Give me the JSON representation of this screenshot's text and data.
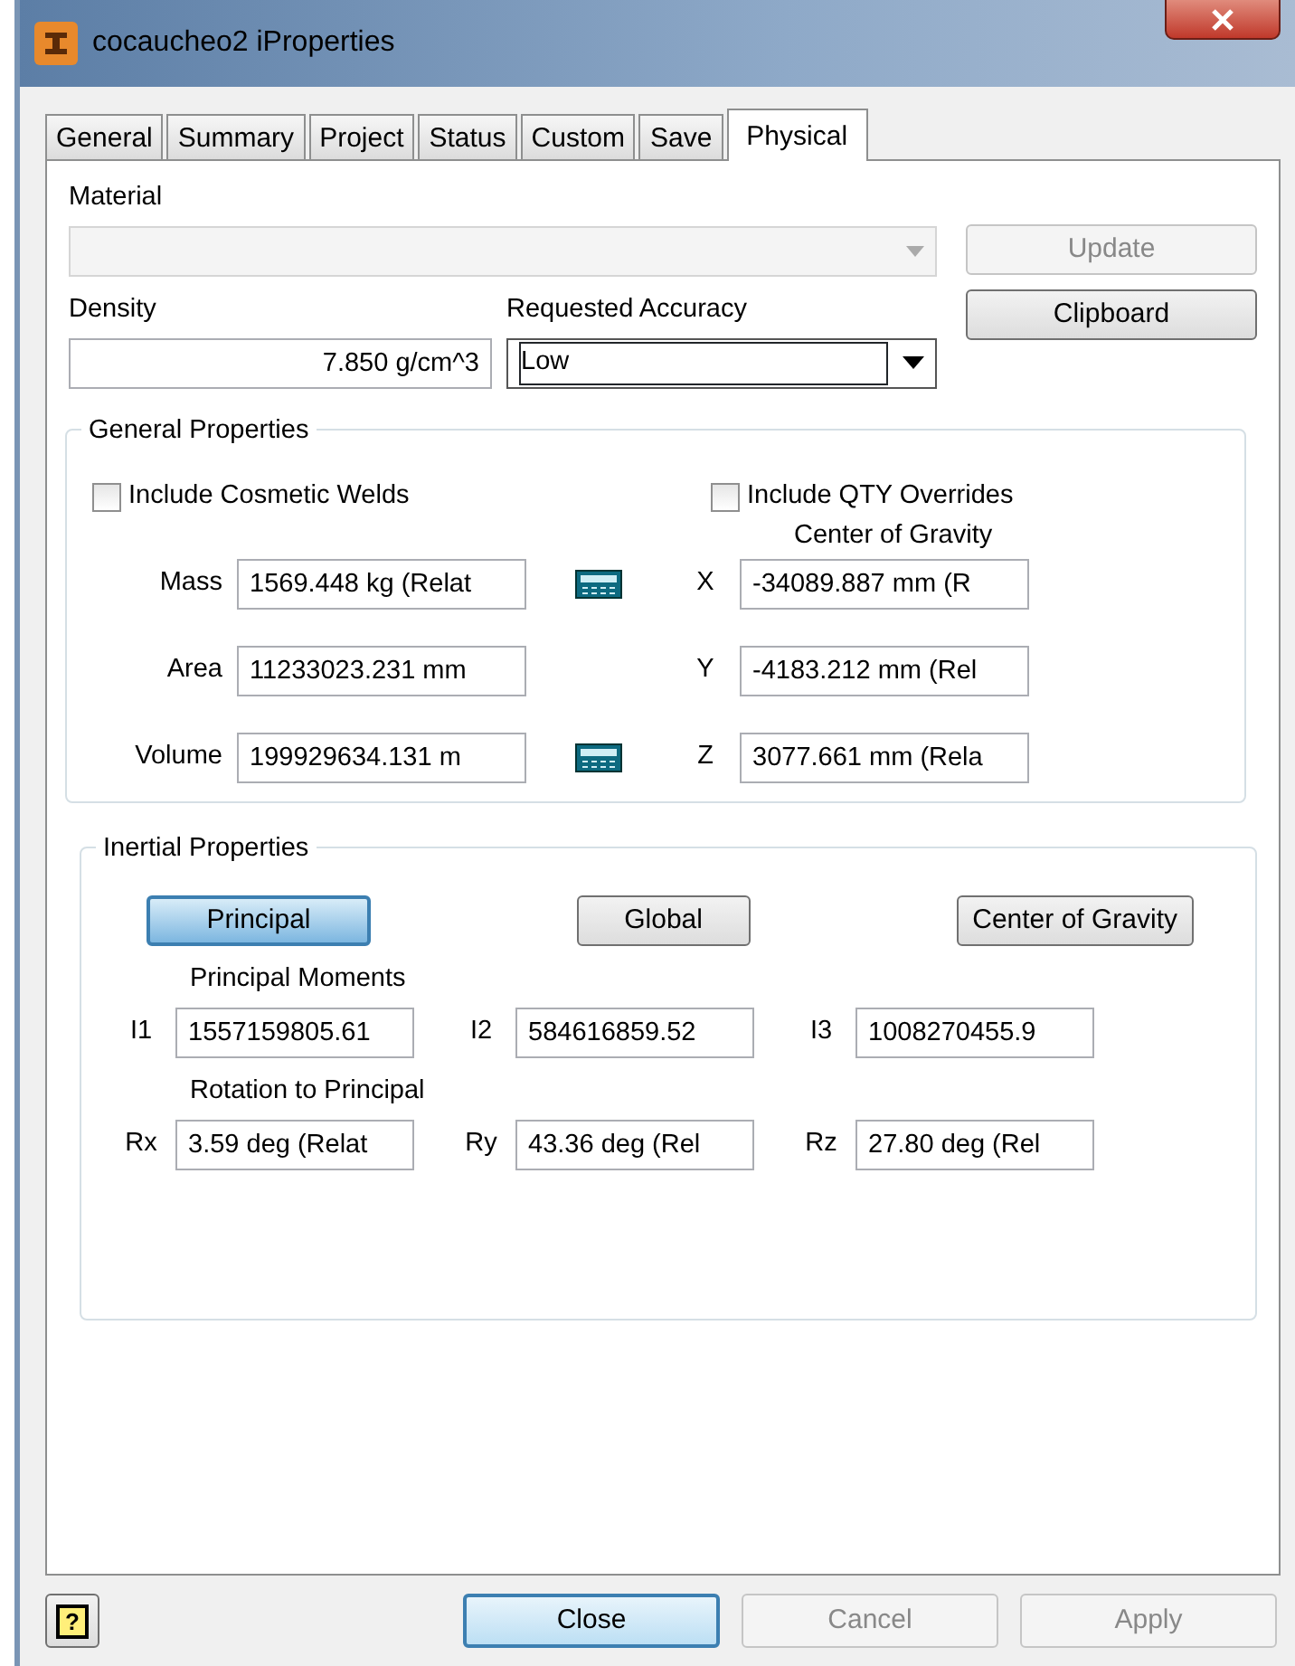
{
  "window": {
    "title": "cocaucheo2 iProperties"
  },
  "tabs": [
    {
      "label": "General",
      "selected": false
    },
    {
      "label": "Summary",
      "selected": false
    },
    {
      "label": "Project",
      "selected": false
    },
    {
      "label": "Status",
      "selected": false
    },
    {
      "label": "Custom",
      "selected": false
    },
    {
      "label": "Save",
      "selected": false
    },
    {
      "label": "Physical",
      "selected": true
    }
  ],
  "material": {
    "label": "Material",
    "disabled": true
  },
  "update_button": {
    "label": "Update",
    "disabled": true
  },
  "density": {
    "label": "Density",
    "value": "7.850 g/cm^3"
  },
  "accuracy": {
    "label": "Requested Accuracy",
    "value": "Low"
  },
  "clipboard_button": {
    "label": "Clipboard",
    "disabled": false
  },
  "general_properties": {
    "title": "General Properties",
    "checkboxes": [
      {
        "label": "Include Cosmetic Welds",
        "checked": false
      },
      {
        "label": "Include QTY Overrides",
        "checked": false
      }
    ],
    "cog_title": "Center of Gravity",
    "rows": [
      {
        "label": "Mass",
        "value": "1569.448 kg (Relat",
        "calculator": true,
        "axis": "X",
        "axis_value": "-34089.887 mm (R"
      },
      {
        "label": "Area",
        "value": "11233023.231 mm",
        "calculator": false,
        "axis": "Y",
        "axis_value": "-4183.212 mm (Rel"
      },
      {
        "label": "Volume",
        "value": "199929634.131 m",
        "calculator": true,
        "axis": "Z",
        "axis_value": "3077.661 mm (Rela"
      }
    ]
  },
  "inertial_properties": {
    "title": "Inertial Properties",
    "modes": [
      {
        "label": "Principal",
        "selected": true
      },
      {
        "label": "Global",
        "selected": false
      },
      {
        "label": "Center of Gravity",
        "selected": false
      }
    ],
    "moments_title": "Principal Moments",
    "moments": [
      {
        "label": "I1",
        "value": "1557159805.61"
      },
      {
        "label": "I2",
        "value": "584616859.52"
      },
      {
        "label": "I3",
        "value": "1008270455.9"
      }
    ],
    "rotation_title": "Rotation to Principal",
    "rotations": [
      {
        "label": "Rx",
        "value": "3.59 deg (Relat"
      },
      {
        "label": "Ry",
        "value": "43.36 deg (Rel"
      },
      {
        "label": "Rz",
        "value": "27.80 deg (Rel"
      }
    ]
  },
  "footer": {
    "help": "?",
    "buttons": [
      {
        "label": "Close",
        "disabled": false,
        "default": true
      },
      {
        "label": "Cancel",
        "disabled": true,
        "default": false
      },
      {
        "label": "Apply",
        "disabled": true,
        "default": false
      }
    ]
  }
}
